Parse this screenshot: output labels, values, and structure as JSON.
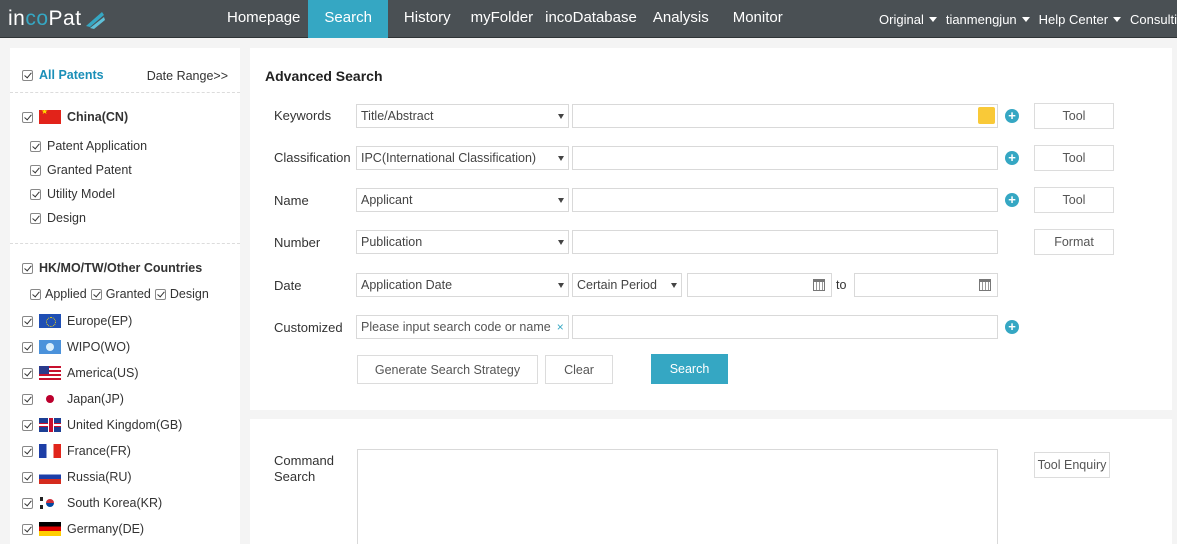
{
  "logo": {
    "text_a": "in",
    "text_b": "co",
    "text_c": "Pat"
  },
  "nav": {
    "items": [
      {
        "label": "Homepage"
      },
      {
        "label": "Search"
      },
      {
        "label": "History"
      },
      {
        "label": "myFolder"
      },
      {
        "label": "incoDatabase"
      },
      {
        "label": "Analysis"
      },
      {
        "label": "Monitor"
      }
    ],
    "active": "Search",
    "right": [
      {
        "label": "Original"
      },
      {
        "label": "tianmengjun"
      },
      {
        "label": "Help Center"
      },
      {
        "label": "Consulti"
      }
    ]
  },
  "sidebar": {
    "all_patents": "All Patents",
    "date_range": "Date Range>>",
    "china": "China(CN)",
    "china_types": [
      "Patent Application",
      "Granted Patent",
      "Utility Model",
      "Design"
    ],
    "other_group": "HK/MO/TW/Other Countries",
    "other_types": [
      "Applied",
      "Granted",
      "Design"
    ],
    "countries": [
      {
        "label": "Europe(EP)",
        "flag": "eu-flag-icon"
      },
      {
        "label": "WIPO(WO)",
        "flag": "wipo-flag-icon"
      },
      {
        "label": "America(US)",
        "flag": "us-flag-icon"
      },
      {
        "label": "Japan(JP)",
        "flag": "jp-flag-icon"
      },
      {
        "label": "United Kingdom(GB)",
        "flag": "gb-flag-icon"
      },
      {
        "label": "France(FR)",
        "flag": "fr-flag-icon"
      },
      {
        "label": "Russia(RU)",
        "flag": "ru-flag-icon"
      },
      {
        "label": "South Korea(KR)",
        "flag": "kr-flag-icon"
      },
      {
        "label": "Germany(DE)",
        "flag": "de-flag-icon"
      }
    ]
  },
  "advanced": {
    "title": "Advanced Search",
    "rows": {
      "keywords": {
        "label": "Keywords",
        "select": "Title/Abstract",
        "tool": "Tool"
      },
      "classification": {
        "label": "Classification",
        "select": "IPC(International Classification)",
        "tool": "Tool"
      },
      "name": {
        "label": "Name",
        "select": "Applicant",
        "tool": "Tool"
      },
      "number": {
        "label": "Number",
        "select": "Publication",
        "tool": "Format"
      },
      "date": {
        "label": "Date",
        "select": "Application Date",
        "period": "Certain Period",
        "to": "to"
      },
      "customized": {
        "label": "Customized",
        "placeholder": "Please input search code or name",
        "clear": "×"
      }
    },
    "buttons": {
      "generate": "Generate Search Strategy",
      "clear": "Clear",
      "search": "Search"
    }
  },
  "command": {
    "label_line1": "Command",
    "label_line2": "Search",
    "tool": "Tool Enquiry"
  },
  "colors": {
    "nav_bg": "#4a5054",
    "accent": "#35a7c3",
    "swatch": "#f9c938"
  }
}
